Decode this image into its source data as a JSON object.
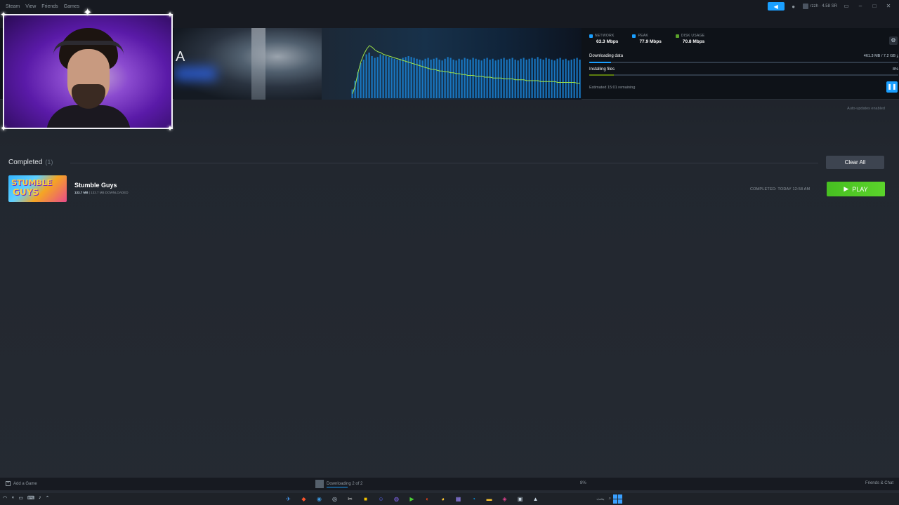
{
  "titlebar": {
    "menu": [
      "Steam",
      "View",
      "Friends",
      "Games"
    ],
    "user_label": "rzzh · 4.58 SR"
  },
  "download_header": {
    "stats": [
      {
        "label": "NETWORK",
        "value": "63.3 Mbps",
        "color": "#1a9fff"
      },
      {
        "label": "PEAK",
        "value": "77.9 Mbps",
        "color": "#1a9fff"
      },
      {
        "label": "DISK USAGE",
        "value": "70.8 Mbps",
        "color": "#5ba32b"
      }
    ],
    "downloading_label": "Downloading data",
    "downloading_value": "461.3 MB / 7.2 GB",
    "downloading_progress": 0.07,
    "installing_label": "Installing files",
    "installing_value": "8%",
    "installing_progress": 0.08,
    "estimated": "Estimated 15:01 remaining",
    "auto_updates": "Auto-updates enabled",
    "hero_letter": "A"
  },
  "completed": {
    "title": "Completed",
    "count": "(1)",
    "clear_all": "Clear All",
    "items": [
      {
        "name": "Stumble Guys",
        "size_main": "133.7 MB",
        "size_rest": " | 133.7 MB DOWNLOADED",
        "completed_text": "COMPLETED: TODAY 12:58 AM",
        "play_label": "PLAY",
        "capsule_line1": "STUMBLE",
        "capsule_line2": "GUYS"
      }
    ]
  },
  "statusbar": {
    "add_game": "Add a Game",
    "downloading": "Downloading 2 of 2",
    "percent": "8%",
    "friends_chat": "Friends & Chat"
  },
  "taskbar": {
    "search_text": "بحث"
  },
  "colors": {
    "accent": "#1a9fff",
    "play_green": "#5bd42b",
    "graph_line": "#9ee34a"
  },
  "chart_data": {
    "type": "bar",
    "series": [
      {
        "name": "Network",
        "values": [
          10,
          20,
          30,
          40,
          44,
          50,
          52,
          48,
          46,
          47,
          50,
          49,
          48,
          47,
          46,
          45,
          44,
          45,
          46,
          47,
          48,
          47,
          46,
          45,
          44,
          43,
          45,
          46,
          44,
          45,
          46,
          44,
          43,
          45,
          47,
          46,
          44,
          43,
          45,
          44,
          46,
          45,
          44,
          46,
          45,
          44,
          43,
          45,
          46,
          44,
          45,
          43,
          44,
          45,
          46,
          44,
          45,
          46,
          44,
          43,
          45,
          46,
          44,
          45,
          46,
          45,
          47,
          45,
          44,
          46,
          45,
          44,
          43,
          45,
          46,
          44,
          45,
          43,
          44,
          45,
          46,
          44
        ]
      },
      {
        "name": "Disk",
        "values": [
          5,
          15,
          30,
          42,
          50,
          56,
          60,
          58,
          55,
          53,
          52,
          50,
          49,
          48,
          47,
          46,
          45,
          44,
          43,
          42,
          41,
          40,
          39,
          38,
          37,
          36,
          35,
          34,
          33,
          33,
          32,
          31,
          31,
          30,
          30,
          29,
          29,
          28,
          28,
          27,
          27,
          26,
          26,
          26,
          25,
          25,
          25,
          24,
          24,
          24,
          23,
          23,
          23,
          23,
          22,
          22,
          22,
          22,
          21,
          21,
          21,
          21,
          20,
          20,
          20,
          20,
          20,
          19,
          19,
          19,
          19,
          19,
          19,
          18,
          18,
          18,
          18,
          18,
          18,
          18,
          17,
          17
        ]
      }
    ]
  }
}
